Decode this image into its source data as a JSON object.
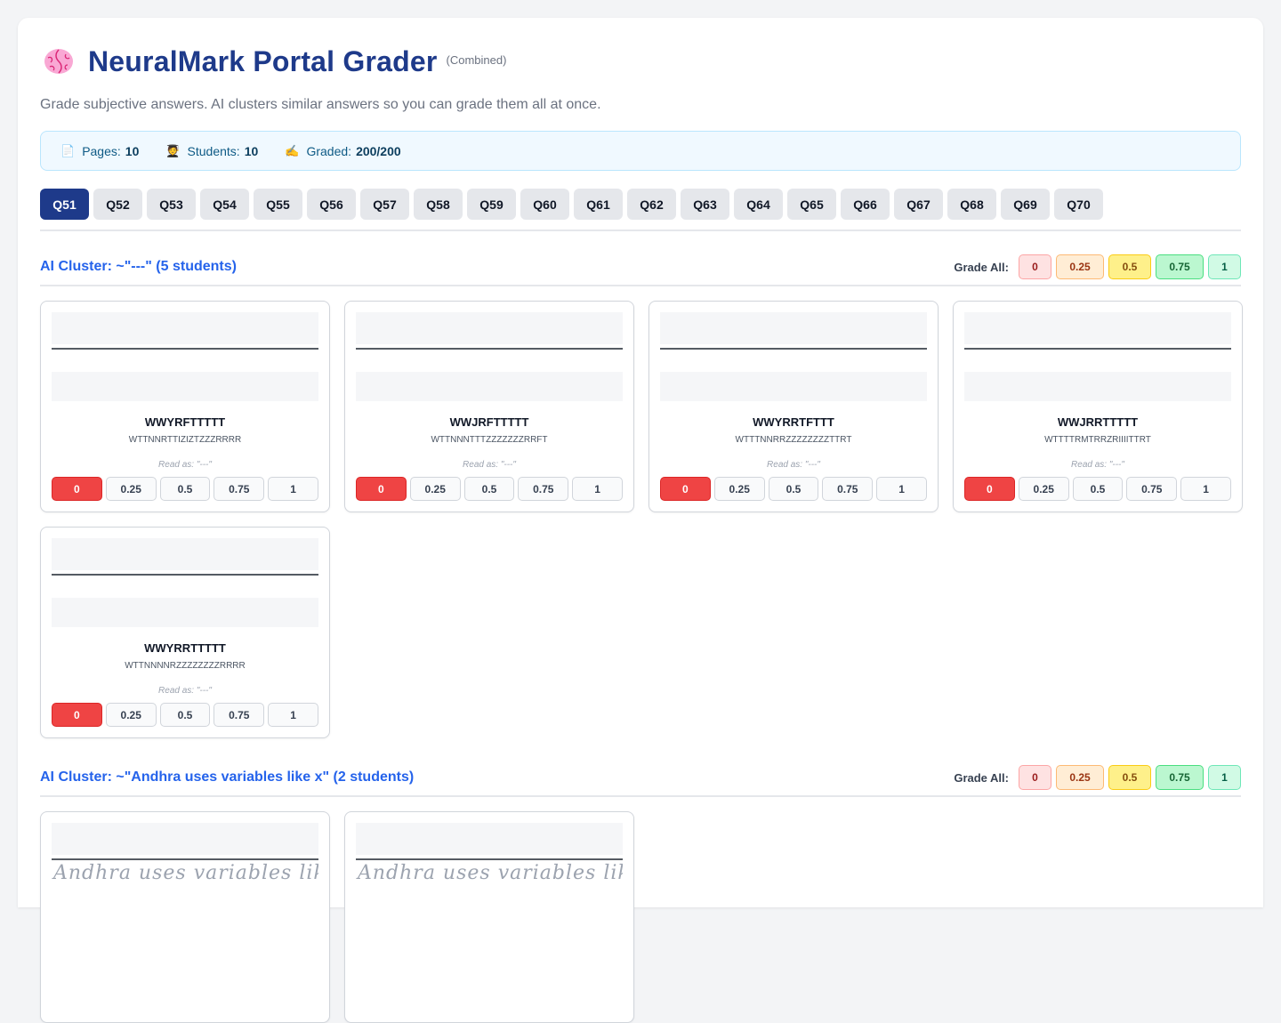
{
  "header": {
    "title": "NeuralMark Portal Grader",
    "mode": "(Combined)",
    "subtitle": "Grade subjective answers. AI clusters similar answers so you can grade them all at once."
  },
  "stats": {
    "pages_label": "Pages:",
    "pages_value": "10",
    "students_label": "Students:",
    "students_value": "10",
    "graded_label": "Graded:",
    "graded_value": "200/200",
    "icons": [
      "page-icon",
      "student-icon",
      "writing-hand-icon"
    ]
  },
  "tabs": [
    "Q51",
    "Q52",
    "Q53",
    "Q54",
    "Q55",
    "Q56",
    "Q57",
    "Q58",
    "Q59",
    "Q60",
    "Q61",
    "Q62",
    "Q63",
    "Q64",
    "Q65",
    "Q66",
    "Q67",
    "Q68",
    "Q69",
    "Q70"
  ],
  "active_tab": "Q51",
  "grade_all_label": "Grade All:",
  "grade_options": [
    "0",
    "0.25",
    "0.5",
    "0.75",
    "1"
  ],
  "clusters": [
    {
      "title": "AI Cluster: ~\"---\" (5 students)",
      "cards": [
        {
          "roll": "WWYRFTTTTT",
          "name": "WTTNNRTTIZIZTZZZRRRR",
          "read_as": "Read as: \"---\"",
          "selected": "0"
        },
        {
          "roll": "WWJRFTTTTT",
          "name": "WTTNNNTTTZZZZZZZRRFT",
          "read_as": "Read as: \"---\"",
          "selected": "0"
        },
        {
          "roll": "WWYRRTFTTT",
          "name": "WTTTNNRRZZZZZZZZTTRT",
          "read_as": "Read as: \"---\"",
          "selected": "0"
        },
        {
          "roll": "WWJRRTTTTT",
          "name": "WTTTTRMTRRZRIIIITTRT",
          "read_as": "Read as: \"---\"",
          "selected": "0"
        },
        {
          "roll": "WWYRRTTTTT",
          "name": "WTTNNNNRZZZZZZZZRRRR",
          "read_as": "Read as: \"---\"",
          "selected": "0"
        }
      ]
    },
    {
      "title": "AI Cluster: ~\"Andhra uses variables like x\" (2 students)",
      "cards": [
        {
          "handwriting": "Andhra uses variables like x"
        },
        {
          "handwriting": "Andhra uses variables like x"
        }
      ]
    }
  ],
  "colors": {
    "title": "#1e3a8a",
    "cluster_title": "#2563eb",
    "selected_zero": "#ef4444",
    "active_tab": "#1e3a8a"
  }
}
